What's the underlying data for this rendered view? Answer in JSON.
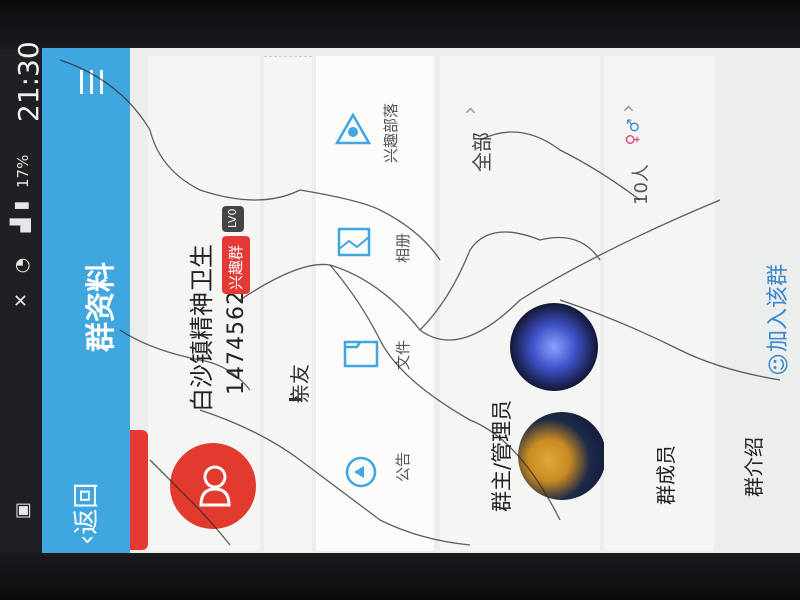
{
  "status": {
    "time": "21:30",
    "battery": "17%"
  },
  "header": {
    "back_label": "返回",
    "title": "群资料"
  },
  "group": {
    "name": "白沙镇精神卫生",
    "id": "147456222",
    "badge": "兴趣群",
    "level": "LV0"
  },
  "category": {
    "label": "亲友"
  },
  "actions": [
    {
      "label": "公告"
    },
    {
      "label": "文件"
    },
    {
      "label": "相册"
    },
    {
      "label": "兴趣部落"
    }
  ],
  "admins": {
    "label": "群主/管理员",
    "all_label": "全部"
  },
  "members": {
    "label": "群成员",
    "count": "10人"
  },
  "intro": {
    "label": "群介绍"
  },
  "join": {
    "label": "加入该群"
  },
  "colors": {
    "titlebar": "#3fa6e0",
    "avatar": "#e33a2f",
    "badge": "#e53935",
    "join": "#3a88cf"
  },
  "icons": [
    "back-arrow-icon",
    "menu-icon",
    "signal-icon",
    "wifi-icon",
    "battery-icon",
    "announcement-icon",
    "file-icon",
    "album-icon",
    "tribe-icon",
    "gender-icon",
    "chevron-right-icon",
    "join-group-icon"
  ]
}
